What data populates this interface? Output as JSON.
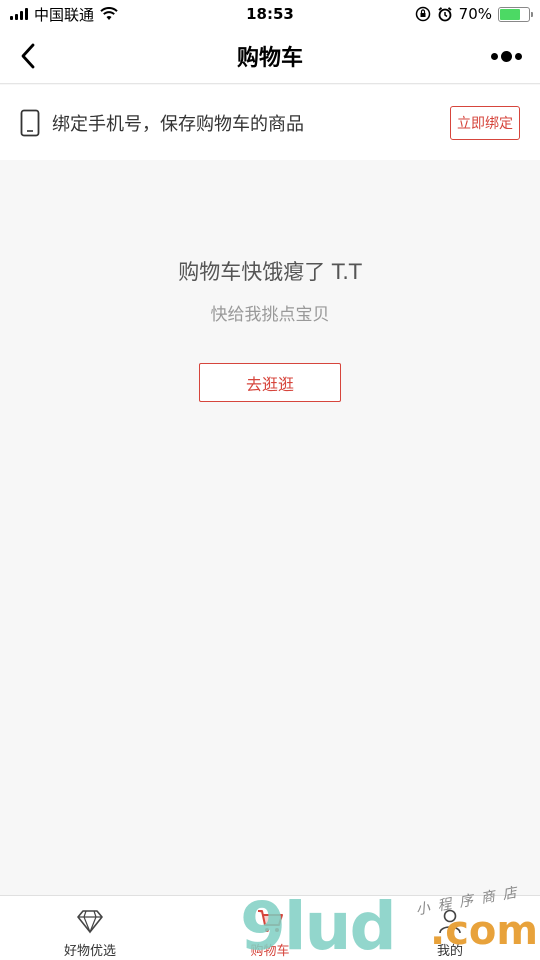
{
  "status_bar": {
    "carrier": "中国联通",
    "time": "18:53",
    "battery": "70%",
    "battery_level": 0.7
  },
  "nav": {
    "title": "购物车"
  },
  "bind_bar": {
    "text": "绑定手机号，保存购物车的商品",
    "button_label": "立即绑定"
  },
  "empty_state": {
    "title": "购物车快饿瘪了 T.T",
    "subtitle": "快给我挑点宝贝",
    "button_label": "去逛逛"
  },
  "tab_bar": {
    "tabs": [
      {
        "label": "好物优选",
        "icon": "diamond-icon",
        "active": false
      },
      {
        "label": "购物车",
        "icon": "cart-icon",
        "active": true
      },
      {
        "label": "我的",
        "icon": "user-icon",
        "active": false
      }
    ]
  },
  "watermark": {
    "main": "9lud",
    "suffix": ".com",
    "tagline": "小程序商店"
  },
  "colors": {
    "accent": "#d6453c",
    "battery": "#4cd964",
    "background": "#f7f7f7"
  }
}
